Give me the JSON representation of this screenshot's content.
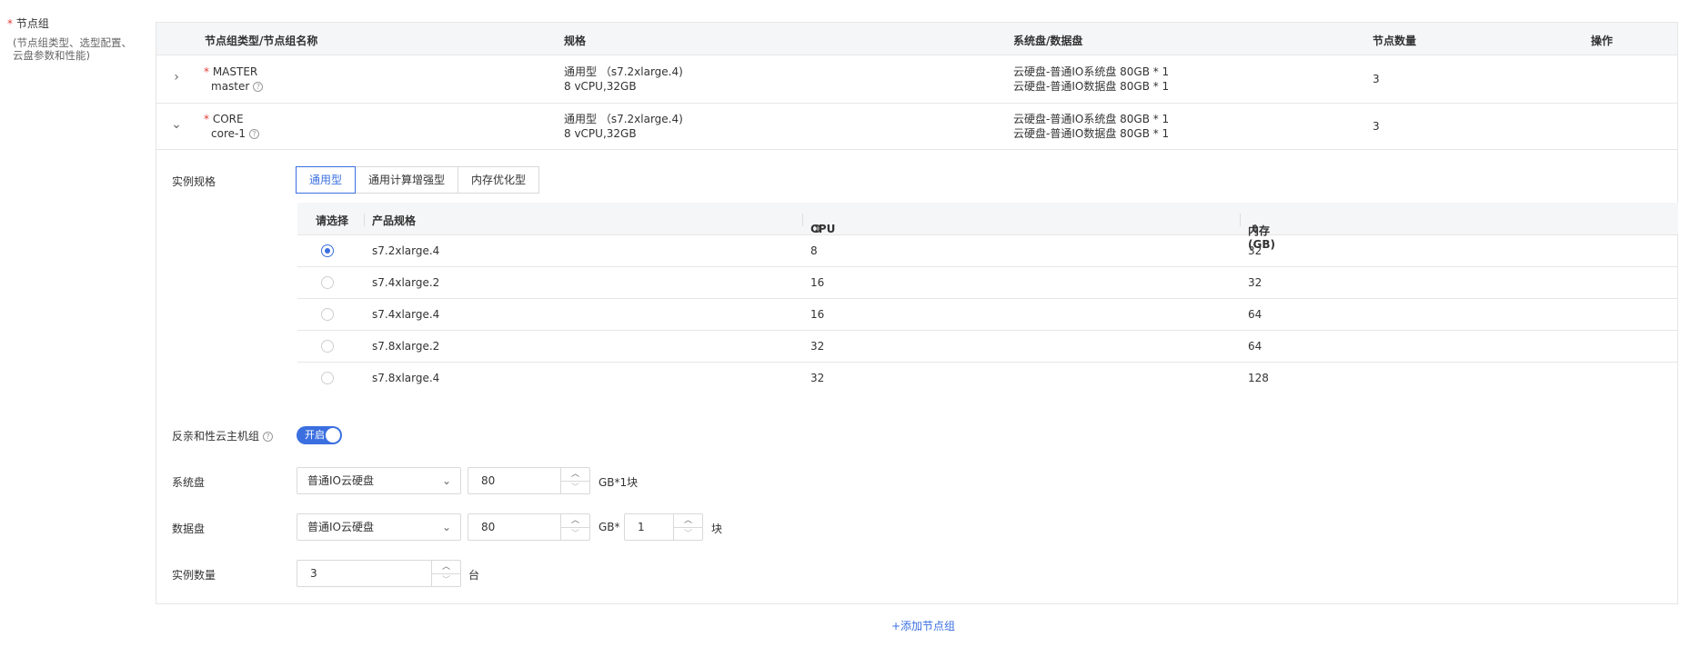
{
  "section": {
    "required_mark": "*",
    "label": "节点组",
    "hint": "(节点组类型、选型配置、云盘参数和性能)"
  },
  "table": {
    "headers": [
      "节点组类型/节点组名称",
      "规格",
      "系统盘/数据盘",
      "节点数量",
      "操作"
    ],
    "rows": [
      {
        "required_mark": "*",
        "type": "MASTER",
        "name": "master",
        "spec_line1": "通用型 （s7.2xlarge.4)",
        "spec_line2": "8 vCPU,32GB",
        "disk_line1": "云硬盘-普通IO系统盘 80GB * 1",
        "disk_line2": "云硬盘-普通IO数据盘 80GB * 1",
        "count": "3",
        "expanded": false
      },
      {
        "required_mark": "*",
        "type": "CORE",
        "name": "core-1",
        "spec_line1": "通用型 （s7.2xlarge.4)",
        "spec_line2": "8 vCPU,32GB",
        "disk_line1": "云硬盘-普通IO系统盘 80GB * 1",
        "disk_line2": "云硬盘-普通IO数据盘 80GB * 1",
        "count": "3",
        "expanded": true
      }
    ]
  },
  "detail": {
    "instance_spec_label": "实例规格",
    "spec_tabs": [
      "通用型",
      "通用计算增强型",
      "内存优化型"
    ],
    "active_tab": 0,
    "spec_headers": {
      "select": "请选择",
      "product": "产品规格",
      "cpu": "CPU",
      "mem": "内存(GB)"
    },
    "spec_rows": [
      {
        "product": "s7.2xlarge.4",
        "cpu": "8",
        "mem": "32",
        "selected": true
      },
      {
        "product": "s7.4xlarge.2",
        "cpu": "16",
        "mem": "32",
        "selected": false
      },
      {
        "product": "s7.4xlarge.4",
        "cpu": "16",
        "mem": "64",
        "selected": false
      },
      {
        "product": "s7.8xlarge.2",
        "cpu": "32",
        "mem": "64",
        "selected": false
      },
      {
        "product": "s7.8xlarge.4",
        "cpu": "32",
        "mem": "128",
        "selected": false
      }
    ],
    "anti_affinity_label": "反亲和性云主机组",
    "anti_affinity_toggle": "开启",
    "system_disk_label": "系统盘",
    "system_disk_type": "普通IO云硬盘",
    "system_disk_size": "80",
    "system_disk_unit": "GB*1块",
    "data_disk_label": "数据盘",
    "data_disk_type": "普通IO云硬盘",
    "data_disk_size": "80",
    "data_disk_unit": "GB*",
    "data_disk_count": "1",
    "data_disk_count_unit": "块",
    "instance_count_label": "实例数量",
    "instance_count": "3",
    "instance_count_unit": "台"
  },
  "add_node_group": "+添加节点组",
  "colors": {
    "accent": "#3b6fe0",
    "required": "#e23c39"
  }
}
